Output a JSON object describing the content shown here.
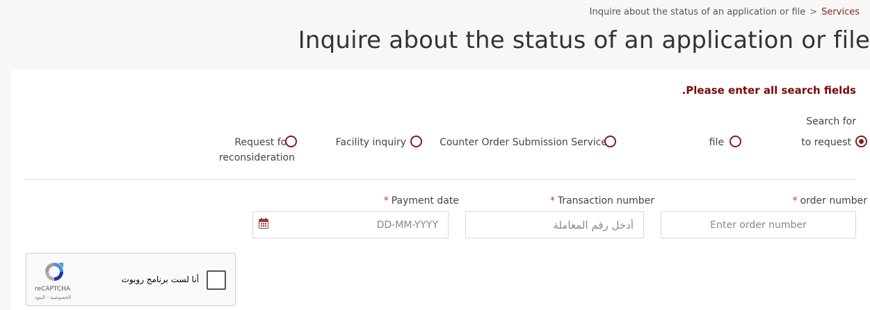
{
  "breadcrumb": {
    "current": "Inquire about the status of an application or file",
    "separator": ">",
    "link": "Services"
  },
  "page_title": "Inquire about the status of an application or file",
  "form": {
    "alert": ".Please enter all search fields",
    "search_label": "Search for",
    "radios": [
      {
        "label": "to request",
        "checked": true
      },
      {
        "label": "file",
        "checked": false
      },
      {
        "label": "Counter Order Submission Service",
        "checked": false
      },
      {
        "label": "Facility inquiry",
        "checked": false
      },
      {
        "label_line1": "Request for",
        "label_line2": "reconsideration",
        "checked": false
      }
    ],
    "fields": {
      "order_number": {
        "label": "order number",
        "required": "*",
        "placeholder": "Enter order number"
      },
      "transaction_number": {
        "label": "Transaction number",
        "required": "*",
        "placeholder": "أدخل رقم المعاملة"
      },
      "payment_date": {
        "label": "Payment date",
        "required": "*",
        "placeholder": "DD-MM-YYYY"
      }
    }
  },
  "captcha": {
    "label": "أنا لست برنامج روبوت",
    "brand": "reCAPTCHA",
    "links": "الخصوصية - البنود"
  },
  "colors": {
    "accent": "#7a1f1f",
    "alert": "#7a0a0a",
    "required": "#c0392b",
    "background": "#f8f7f5"
  },
  "icons": [
    "chevron-right-icon",
    "radio-icon",
    "calendar-icon",
    "recaptcha-logo-icon",
    "checkbox-icon"
  ]
}
